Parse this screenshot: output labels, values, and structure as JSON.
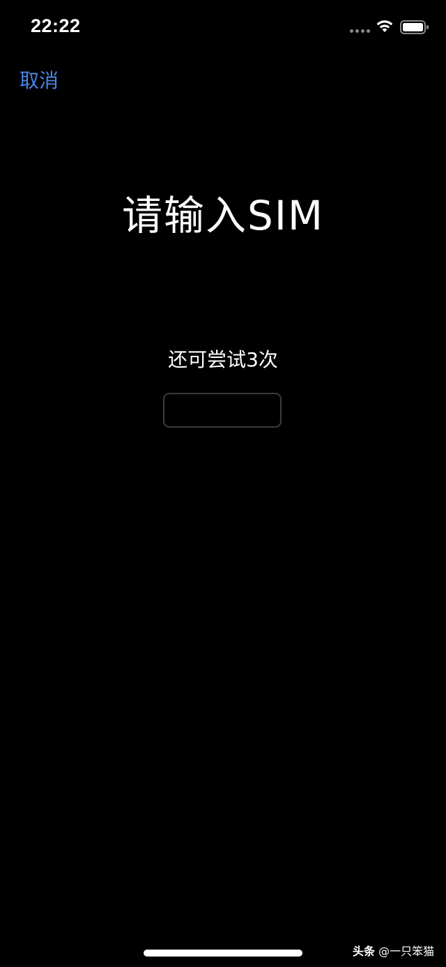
{
  "status_bar": {
    "time": "22:22",
    "icons": [
      "signal-dots-icon",
      "wifi-icon",
      "battery-icon"
    ]
  },
  "nav": {
    "cancel_label": "取消"
  },
  "main": {
    "title": "请输入SIM",
    "attempts_text": "还可尝试3次",
    "pin_value": "",
    "pin_placeholder": ""
  },
  "watermark": {
    "brand": "头条",
    "handle": "@一只笨猫"
  },
  "colors": {
    "background": "#000000",
    "accent": "#4a86e8",
    "text": "#ffffff",
    "input_border": "#3c3c3c"
  }
}
